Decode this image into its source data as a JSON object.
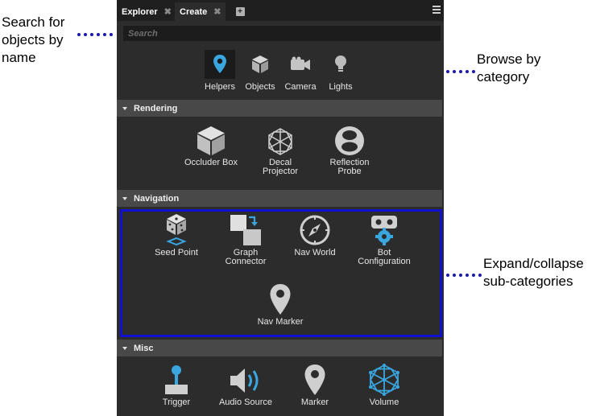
{
  "annotations": {
    "search": "Search for objects by name",
    "browse": "Browse by category",
    "expand": "Expand/collapse sub-categories"
  },
  "tabs": [
    {
      "label": "Explorer"
    },
    {
      "label": "Create"
    }
  ],
  "search": {
    "placeholder": "Search",
    "value": ""
  },
  "categories": [
    {
      "label": "Helpers",
      "icon": "pin-icon",
      "active": true
    },
    {
      "label": "Objects",
      "icon": "cube-icon"
    },
    {
      "label": "Camera",
      "icon": "camera-icon"
    },
    {
      "label": "Lights",
      "icon": "bulb-icon"
    }
  ],
  "sections": [
    {
      "title": "Rendering",
      "items": [
        {
          "label": "Occluder Box",
          "icon": "box-icon"
        },
        {
          "label": "Decal\nProjector",
          "icon": "decal-icon"
        },
        {
          "label": "Reflection\nProbe",
          "icon": "probe-icon"
        }
      ]
    },
    {
      "title": "Navigation",
      "items": [
        {
          "label": "Seed Point",
          "icon": "dice-icon"
        },
        {
          "label": "Graph\nConnector",
          "icon": "graph-icon"
        },
        {
          "label": "Nav World",
          "icon": "compass-icon"
        },
        {
          "label": "Bot\nConfiguration",
          "icon": "bot-icon"
        },
        {
          "label": "Nav Marker",
          "icon": "marker-icon"
        }
      ]
    },
    {
      "title": "Misc",
      "items": [
        {
          "label": "Trigger",
          "icon": "joystick-icon"
        },
        {
          "label": "Audio Source",
          "icon": "speaker-icon"
        },
        {
          "label": "Marker",
          "icon": "marker-icon"
        },
        {
          "label": "Volume",
          "icon": "volume-icon"
        }
      ]
    }
  ],
  "colors": {
    "accent": "#3aa6e0",
    "highlight_frame": "#1010d0",
    "panel": "#2c2c2c"
  }
}
